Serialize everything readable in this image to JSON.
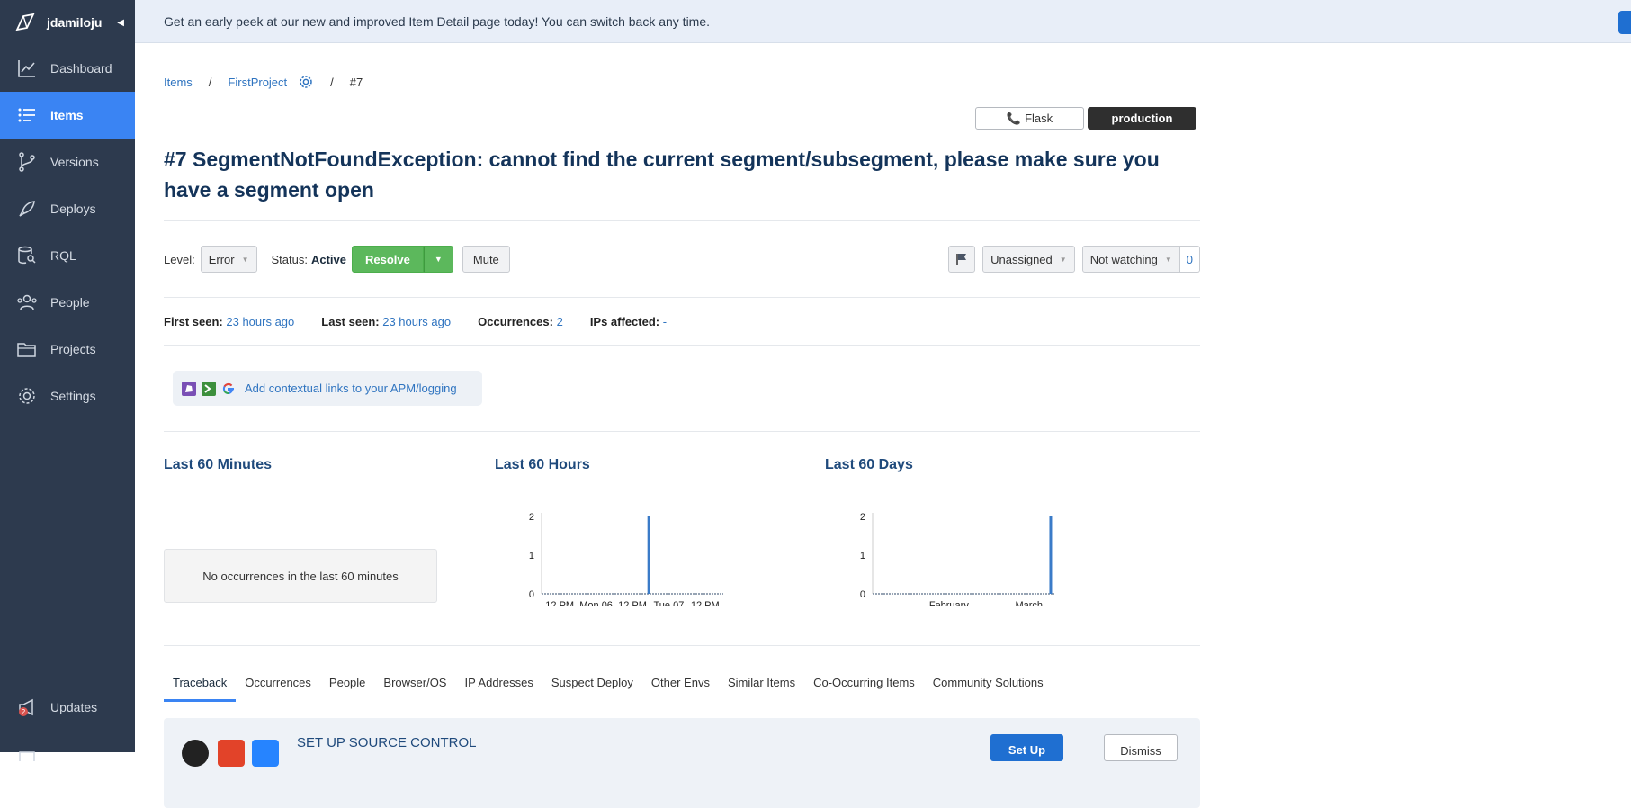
{
  "sidebar": {
    "user": "jdamiloju",
    "items": [
      {
        "label": "Dashboard",
        "icon": "dashboard-icon"
      },
      {
        "label": "Items",
        "icon": "list-icon"
      },
      {
        "label": "Versions",
        "icon": "branch-icon"
      },
      {
        "label": "Deploys",
        "icon": "rocket-icon"
      },
      {
        "label": "RQL",
        "icon": "database-search-icon"
      },
      {
        "label": "People",
        "icon": "people-icon"
      },
      {
        "label": "Projects",
        "icon": "folder-icon"
      },
      {
        "label": "Settings",
        "icon": "gear-icon"
      }
    ],
    "updates_label": "Updates",
    "updates_badge": "2"
  },
  "banner": {
    "text": "Get an early peek at our new and improved Item Detail page today! You can switch back any time."
  },
  "breadcrumb": {
    "items": "Items",
    "sep": "/",
    "project": "FirstProject",
    "item_number": "#7"
  },
  "env": {
    "framework": "Flask",
    "environment": "production"
  },
  "item": {
    "title": "#7 SegmentNotFoundException: cannot find the current segment/subsegment, please make sure you have a segment open"
  },
  "controls": {
    "level_label": "Level:",
    "level_value": "Error",
    "status_label": "Status:",
    "status_value": "Active",
    "resolve_label": "Resolve",
    "mute_label": "Mute",
    "assignee": "Unassigned",
    "watch": "Not watching",
    "watch_count": "0"
  },
  "stats": {
    "first_seen_label": "First seen:",
    "first_seen_value": "23 hours ago",
    "last_seen_label": "Last seen:",
    "last_seen_value": "23 hours ago",
    "occurrences_label": "Occurrences:",
    "occurrences_value": "2",
    "ips_label": "IPs affected:",
    "ips_value": "-"
  },
  "contextual": {
    "label": "Add contextual links to your APM/logging"
  },
  "charts": {
    "minutes_title": "Last 60 Minutes",
    "minutes_empty": "No occurrences in the last 60 minutes",
    "hours_title": "Last 60 Hours",
    "days_title": "Last 60 Days"
  },
  "chart_data": [
    {
      "type": "bar",
      "title": "Last 60 Hours",
      "x_tick_labels": [
        "12 PM",
        "Mon 06",
        "12 PM",
        "Tue 07",
        "12 PM"
      ],
      "y_tick_labels": [
        "0",
        "1",
        "2"
      ],
      "ylim": [
        0,
        2
      ],
      "bar_position": 0.59,
      "values": [
        2
      ]
    },
    {
      "type": "bar",
      "title": "Last 60 Days",
      "x_tick_labels": [
        "February",
        "March"
      ],
      "y_tick_labels": [
        "0",
        "1",
        "2"
      ],
      "ylim": [
        0,
        2
      ],
      "bar_position": 0.98,
      "values": [
        2
      ]
    }
  ],
  "tabs": [
    "Traceback",
    "Occurrences",
    "People",
    "Browser/OS",
    "IP Addresses",
    "Suspect Deploy",
    "Other Envs",
    "Similar Items",
    "Co-Occurring Items",
    "Community Solutions"
  ],
  "source_control": {
    "title": "SET UP SOURCE CONTROL",
    "setup_label": "Set Up",
    "dismiss_label": "Dismiss"
  },
  "colors": {
    "sidebar_bg": "#2d3a4e",
    "active_blue": "#3a84f3",
    "green": "#5cb85c",
    "link_blue": "#2f74c0"
  }
}
